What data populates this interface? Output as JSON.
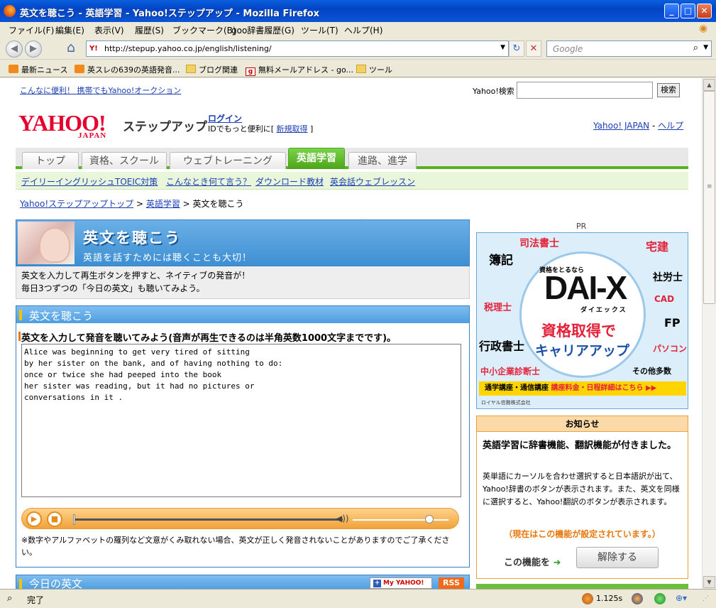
{
  "window": {
    "title": "英文を聴こう - 英語学習 - Yahoo!ステップアップ - Mozilla Firefox",
    "minimize": "_",
    "maximize": "□",
    "close": "✕"
  },
  "menu": [
    "ファイル(F)",
    "編集(E)",
    "表示(V)",
    "履歴(S)",
    "ブックマーク(B)",
    "goo辞書履歴(G)",
    "ツール(T)",
    "ヘルプ(H)"
  ],
  "toolbar": {
    "url": "http://stepup.yahoo.co.jp/english/listening/",
    "favicon_text": "Y!",
    "search_placeholder": "Google",
    "back_glyph": "◀",
    "forward_glyph": "▶",
    "reload_glyph": "↻",
    "stop_glyph": "✕"
  },
  "bookmarks": [
    "最新ニュース",
    "英スレの639の英語発音...",
    "ブログ関連",
    "無料メールアドレス - go...",
    "ツール"
  ],
  "page": {
    "top_promo": "こんなに便利！ 携帯でもYahoo!オークション",
    "search_label": "Yahoo!検索",
    "search_button": "検索",
    "logo_text": "YAHOO!",
    "logo_sub": "JAPAN",
    "service_name": "ステップアップ",
    "login_link": "ログイン",
    "login_sub_prefix": "IDでもっと便利に[ ",
    "register_link": "新規取得",
    "login_sub_suffix": " ]",
    "top_links": {
      "japan": "Yahoo! JAPAN",
      "sep": " - ",
      "help": "ヘルプ"
    },
    "tabs": [
      {
        "label": "トップ",
        "active": false
      },
      {
        "label": "資格、スクール",
        "active": false
      },
      {
        "label": "ウェブトレーニング",
        "active": false
      },
      {
        "label": "英語学習",
        "active": true
      },
      {
        "label": "進路、進学",
        "active": false
      }
    ],
    "subnav": [
      "デイリーイングリッシュ",
      "TOEIC対策",
      "こんなとき何て言う？",
      "ダウンロード教材",
      "英会話ウェブレッスン"
    ],
    "breadcrumb": {
      "home": "Yahoo!ステップアップトップ",
      "sep": " > ",
      "section": "英語学習",
      "current": "英文を聴こう"
    },
    "hero_title": "英文を聴こう",
    "hero_subtitle": "英語を話すためには聴くことも大切！",
    "intro_line1": "英文を入力して再生ボタンを押すと、ネイティブの発音が！",
    "intro_line2": "毎日3つずつの「今日の英文」も聴いてみよう。",
    "section_title": "英文を聴こう",
    "instruction": "英文を入力して発音を聴いてみよう(音声が再生できるのは半角英数1000文字までです)。",
    "textarea_value": "Alice was beginning to get very tired of sitting\nby her sister on the bank, and of having nothing to do:\nonce or twice she had peeped into the book\nher sister was reading, but it had no pictures or\nconversations in it .",
    "player": {
      "play_glyph": "▶",
      "stop_glyph": "■",
      "volume_glyph": "◀))"
    },
    "note": "※数字やアルファベットの羅列など文意がくみ取れない場合、英文が正しく発音されないことがありますのでご了承ください。",
    "today_title": "今日の英文",
    "my_yahoo_label": "My YAHOO!",
    "my_yahoo_plus": "+",
    "rss_label": "RSS"
  },
  "ad": {
    "pr_label": "PR",
    "words": [
      "司法書士",
      "宅建",
      "簿記",
      "社労士",
      "CAD",
      "税理士",
      "FP",
      "行政書士",
      "パソコン",
      "中小企業診断士",
      "その他多数"
    ],
    "brand_top": "資格をとるなら",
    "brand": "DAI-X",
    "brand_kana": "ダイエックス",
    "slogan1": "資格取得で",
    "slogan2": "キャリアアップ",
    "footer_left": "通学講座・通信講座",
    "footer_right": "講座料金・日程詳細はこちら ▶▶",
    "company": "ロイヤル信務株式会社"
  },
  "notice": {
    "header": "お知らせ",
    "headline": "英語学習に辞書機能、翻訳機能が付きました。",
    "body": "英単語にカーソルを合わせ選択すると日本語訳が出て、Yahoo!辞書のボタンが表示されます。また、英文を同様に選択すると、Yahoo!翻訳のボタンが表示されます。",
    "status": "（現在はこの機能が設定されています。）",
    "function_label": "この機能を",
    "arrow": "➜",
    "disable_button": "解除する"
  },
  "status": {
    "text": "完了",
    "time": "1.125s"
  },
  "colors": {
    "accent_green": "#56b21e",
    "panel_blue": "#3b82c4",
    "player_orange": "#f0a23a",
    "yahoo_red": "#e5002d"
  }
}
